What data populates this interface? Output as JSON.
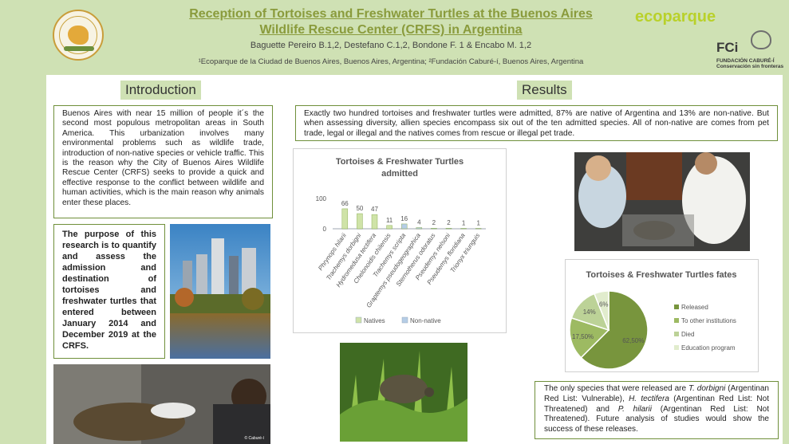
{
  "header": {
    "title_line1": "Reception of Tortoises and Freshwater Turtles at the Buenos Aires",
    "title_line2": "Wildlife Rescue Center (CRFS) in Argentina",
    "authors": "Baguette Pereiro B.1,2, Destefano C.1,2, Bondone F. 1 & Encabo M. 1,2",
    "affiliations": "¹Ecoparque de la Ciudad de Buenos Aires, Buenos Aires, Argentina; ²Fundación Caburé-í, Buenos Aires, Argentina",
    "logo_right_top": "ecoparque",
    "logo_fci": "FCi",
    "logo_fci_sub1": "FUNDACIÓN CABURÉ-Í",
    "logo_fci_sub2": "Conservación sin fronteras"
  },
  "introduction": {
    "heading": "Introduction",
    "text": "Buenos Aires with near 15 million of people it´s the second most populous metropolitan areas in South America. This urbanization involves many environmental problems such as wildlife trade, introduction of non-native species or vehicle traffic. This is the reason why the City of Buenos Aires Wildlife Rescue Center (CRFS) seeks to provide a quick and effective response to the conflict between wildlife and human activities, which is the main reason why animals enter these places.",
    "purpose": "The purpose of this research is to quantify and assess the admission and destination of tortoises and freshwater turtles that entered between January 2014 and December 2019 at the CRFS."
  },
  "results": {
    "heading": "Results",
    "text": "Exactly two hundred tortoises and freshwater turtles were admitted, 87% are native of Argentina and 13% are non-native. But when assessing diversity, allien species encompass six out of the ten admitted species. All of non-native are comes from pet trade, legal or illegal and the natives comes from rescue or illegal pet trade.",
    "conclusion_parts": [
      "The only species that were released are ",
      "T. dorbigni",
      " (Argentinan Red List: Vulnerable), ",
      "H. tectifera",
      " (Argentinan Red List: Not Threatened) and ",
      "P. hilarii",
      " (Argentinan Red List: Not Threatened). Future analysis of studies would show the success of these releases."
    ]
  },
  "photo_credit": "© Caburé-í",
  "chart_data": [
    {
      "type": "bar",
      "title": "Tortoises & Freshwater Turtles admitted",
      "categories": [
        "Phrynops hilarii",
        "Trachemys dorbigni",
        "Hydromedusa tectifera",
        "Chelonoidis chilensis",
        "Trachemys scripta",
        "Graptemys pseudogeographica",
        "Sternotherus odoratus",
        "Pseudemys nelsoni",
        "Pseudemys floridiana",
        "Trionyx triunguis"
      ],
      "values": [
        66,
        50,
        47,
        11,
        16,
        4,
        2,
        2,
        1,
        1
      ],
      "group": [
        "Natives",
        "Natives",
        "Natives",
        "Natives",
        "Non-native",
        "Non-native",
        "Non-native",
        "Non-native",
        "Non-native",
        "Non-native"
      ],
      "ytick_labels": [
        "0",
        "100"
      ],
      "ylim": [
        0,
        100
      ],
      "legend": [
        "Natives",
        "Non-native"
      ],
      "colors": {
        "Natives": "#cfe3a8",
        "Non-native": "#b5cde6"
      },
      "legend_position": "bottom"
    },
    {
      "type": "pie",
      "title": "Tortoises & Freshwater Turtles fates",
      "labels": [
        "Released",
        "To other institutions",
        "Died",
        "Education program"
      ],
      "values": [
        62.5,
        17.5,
        14,
        6
      ],
      "value_labels": [
        "62,50%",
        "17,50%",
        "14%",
        "6%"
      ],
      "colors": [
        "#78953d",
        "#9dba62",
        "#bcd297",
        "#e1eccd"
      ],
      "legend_position": "right"
    }
  ]
}
